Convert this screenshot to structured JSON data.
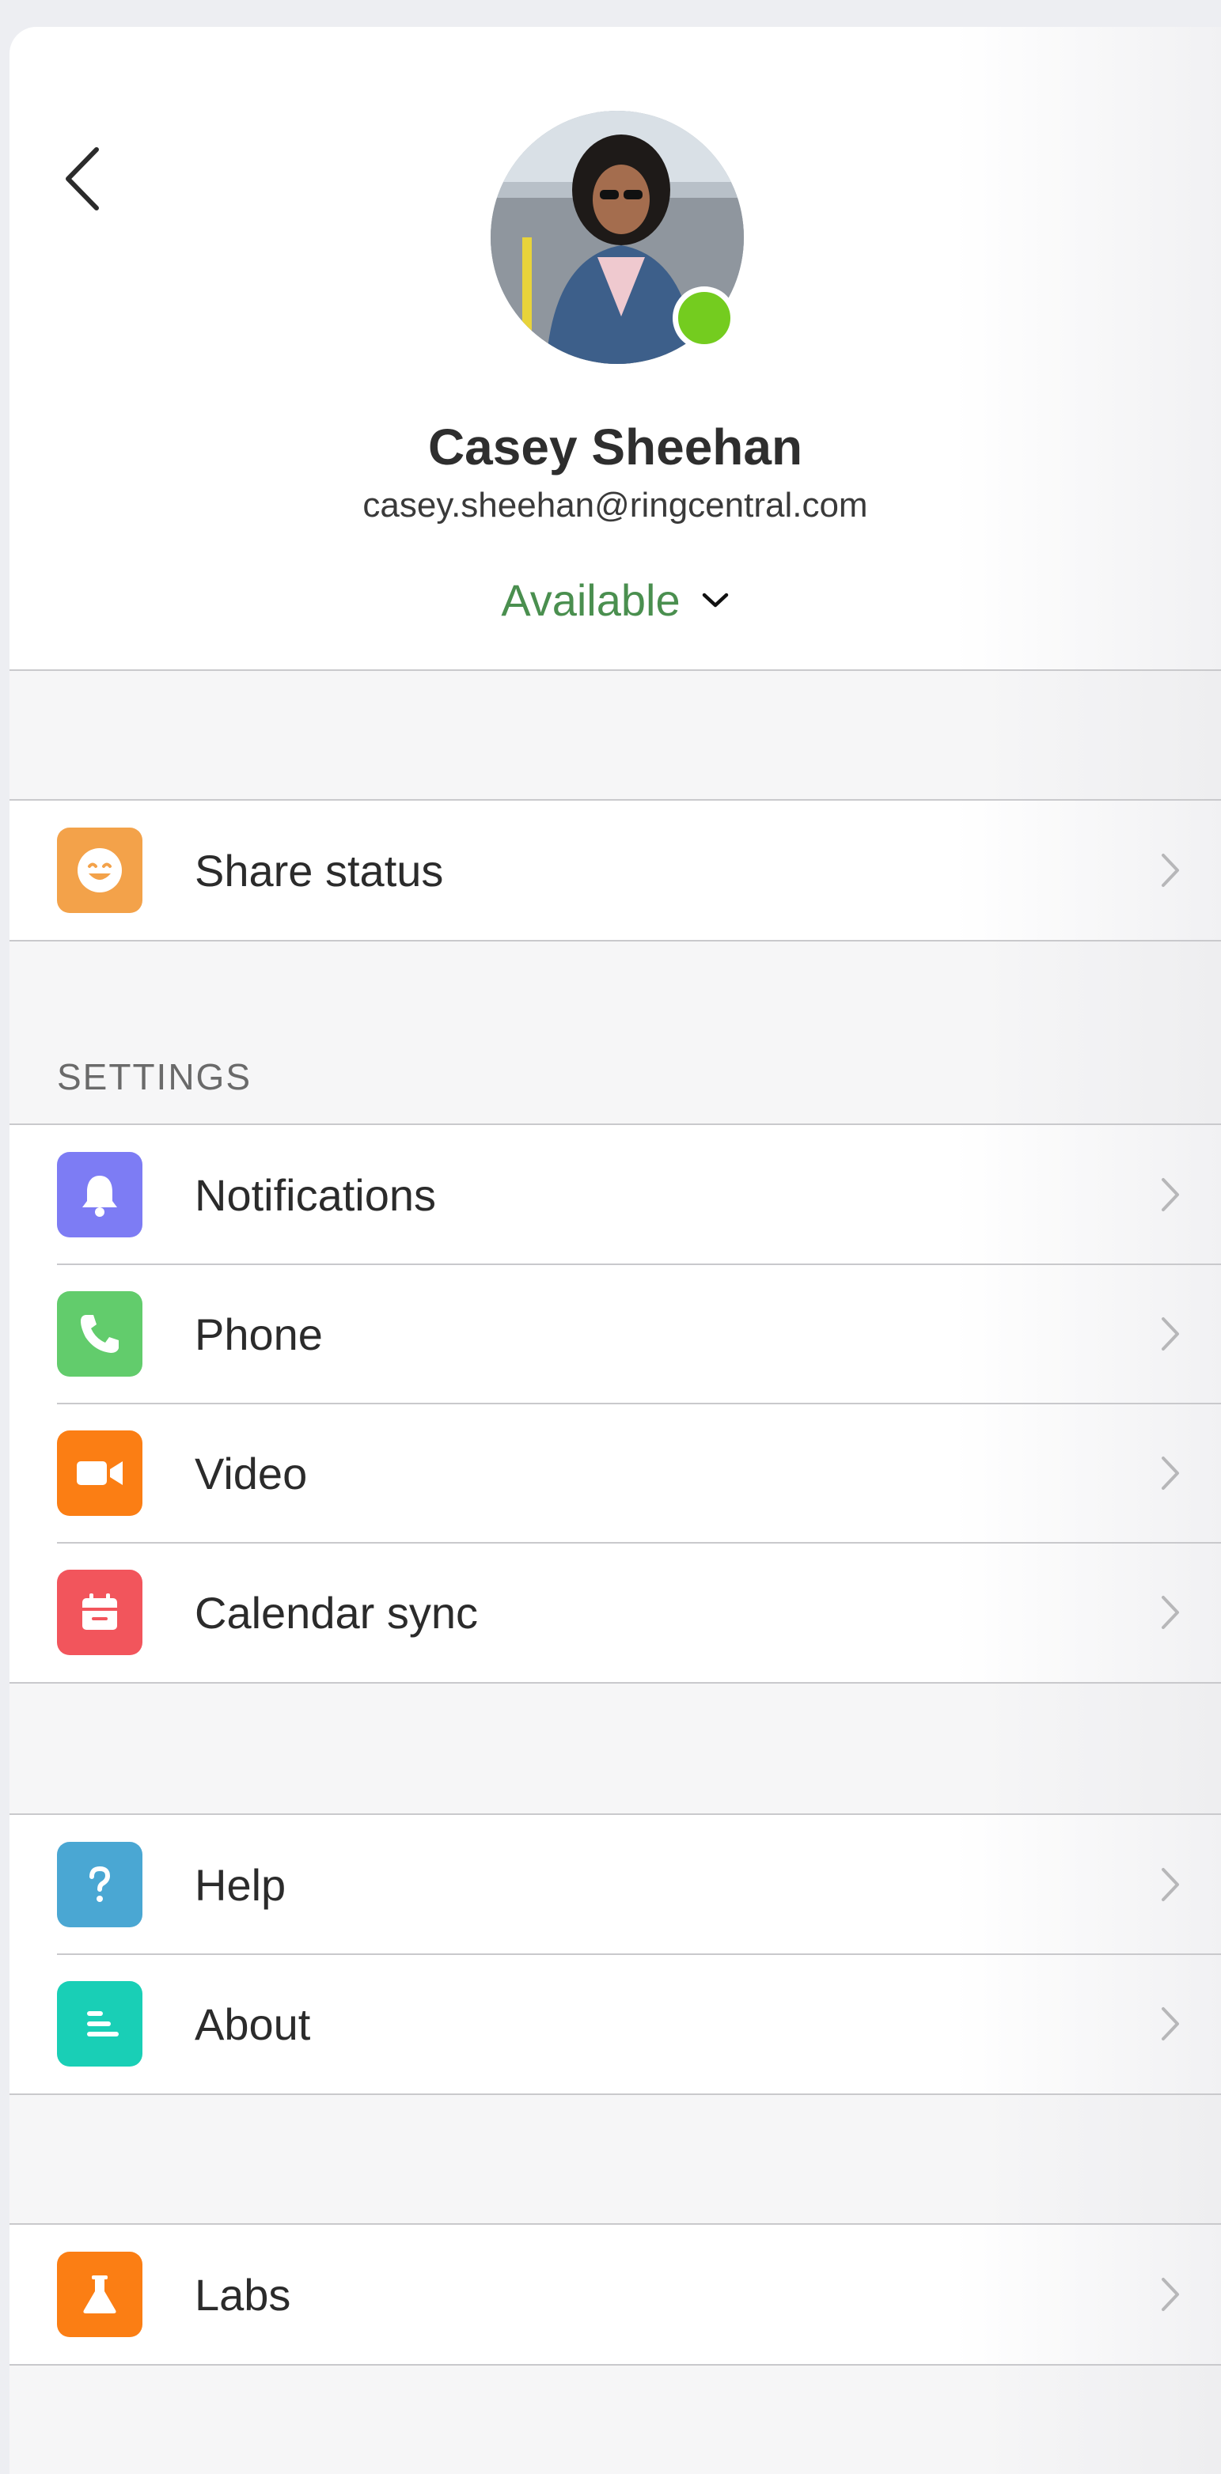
{
  "profile": {
    "name": "Casey Sheehan",
    "email": "casey.sheehan@ringcentral.com",
    "presence_status": "Available",
    "presence_color": "#74cc1f",
    "status_text_color": "#4a8f4f"
  },
  "navigation": {
    "back_icon": "chevron-left-icon"
  },
  "groups": {
    "share": {
      "items": [
        {
          "label": "Share status",
          "icon": "smiley-icon",
          "color": "#f3a24a"
        }
      ]
    },
    "settings": {
      "title": "SETTINGS",
      "items": [
        {
          "label": "Notifications",
          "icon": "bell-icon",
          "color": "#7d7cf4"
        },
        {
          "label": "Phone",
          "icon": "phone-icon",
          "color": "#62cc6c"
        },
        {
          "label": "Video",
          "icon": "video-camera-icon",
          "color": "#fb7e14"
        },
        {
          "label": "Calendar sync",
          "icon": "calendar-icon",
          "color": "#f2555c"
        }
      ]
    },
    "support": {
      "items": [
        {
          "label": "Help",
          "icon": "question-mark-icon",
          "color": "#4aa7d3"
        },
        {
          "label": "About",
          "icon": "about-lines-icon",
          "color": "#19cfb6"
        }
      ]
    },
    "labs": {
      "items": [
        {
          "label": "Labs",
          "icon": "flask-icon",
          "color": "#fb7e14"
        }
      ]
    }
  }
}
